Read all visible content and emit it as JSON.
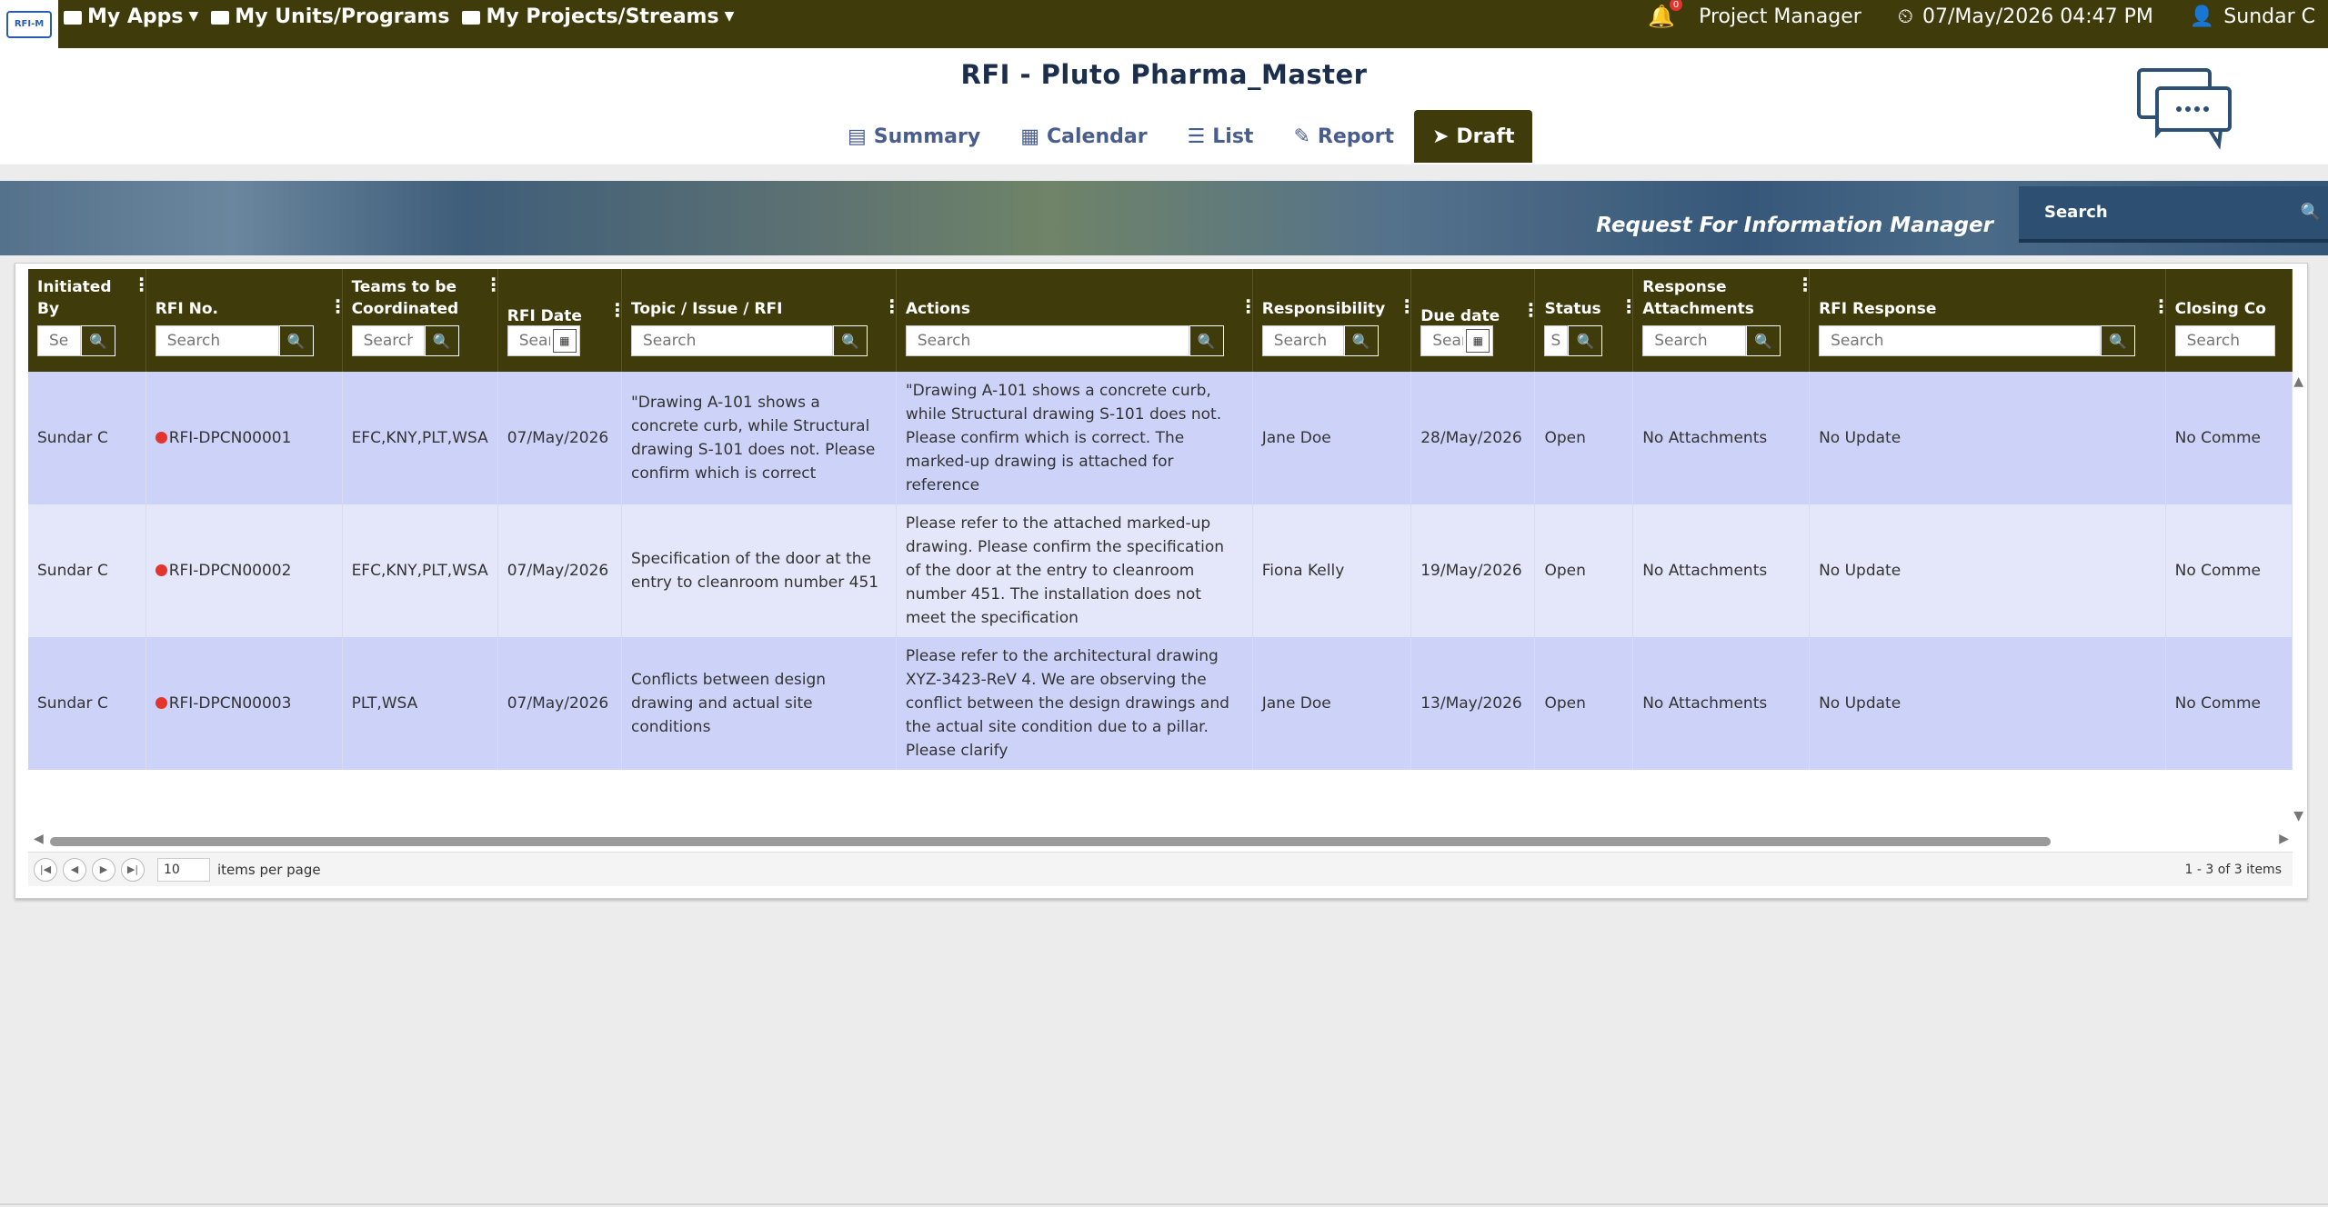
{
  "topbar": {
    "nav": [
      {
        "label": "My Apps",
        "icon": "briefcase-icon",
        "dropdown": true
      },
      {
        "label": "My Units/Programs",
        "icon": "briefcase-icon",
        "dropdown": false
      },
      {
        "label": "My Projects/Streams",
        "icon": "briefcase-icon",
        "dropdown": true
      }
    ],
    "notification_count": "0",
    "role": "Project Manager",
    "datetime": "07/May/2026 04:47 PM",
    "user": "Sundar C",
    "logo_text": "RFI-M"
  },
  "header": {
    "title": "RFI - Pluto Pharma_Master",
    "tabs": [
      {
        "label": "Summary",
        "icon": "summary-icon",
        "active": false
      },
      {
        "label": "Calendar",
        "icon": "calendar-icon",
        "active": false
      },
      {
        "label": "List",
        "icon": "list-icon",
        "active": false
      },
      {
        "label": "Report",
        "icon": "report-icon",
        "active": false
      },
      {
        "label": "Draft",
        "icon": "send-icon",
        "active": true
      }
    ]
  },
  "banner": {
    "title": "Request For Information Manager",
    "search_placeholder": "Search"
  },
  "grid": {
    "columns": [
      {
        "title": "Initiated By",
        "filter": "Sea"
      },
      {
        "title": "RFI No.",
        "filter": "Search"
      },
      {
        "title": "Teams to be Coordinated",
        "filter": "Search"
      },
      {
        "title": "RFI Date",
        "filter": "Searc",
        "date": true
      },
      {
        "title": "Topic / Issue / RFI",
        "filter": "Search"
      },
      {
        "title": "Actions",
        "filter": "Search"
      },
      {
        "title": "Responsibility",
        "filter": "Search"
      },
      {
        "title": "Due date",
        "filter": "Searc",
        "date": true
      },
      {
        "title": "Status",
        "filter": "S"
      },
      {
        "title": "Response Attachments",
        "filter": "Search"
      },
      {
        "title": "RFI Response",
        "filter": "Search"
      },
      {
        "title": "Closing Co",
        "filter": "Search"
      }
    ],
    "rows": [
      {
        "initiated_by": "Sundar C",
        "rfi_no": "RFI-DPCN00001",
        "teams": "EFC,KNY,PLT,WSA",
        "rfi_date": "07/May/2026",
        "topic": "\"Drawing A-101 shows a concrete curb, while Structural drawing S-101 does not. Please confirm which is correct",
        "actions": "\"Drawing A-101 shows a concrete curb, while Structural drawing S-101 does not. Please confirm which is correct. The marked-up drawing is attached for reference",
        "responsibility": "Jane Doe",
        "due_date": "28/May/2026",
        "status": "Open",
        "attachments": "No Attachments",
        "response": "No Update",
        "closing": "No Comme"
      },
      {
        "initiated_by": "Sundar C",
        "rfi_no": "RFI-DPCN00002",
        "teams": "EFC,KNY,PLT,WSA",
        "rfi_date": "07/May/2026",
        "topic": "Specification of the door at the entry to cleanroom number 451",
        "actions": "Please refer to the attached marked-up drawing. Please confirm the specification of the door at the entry to cleanroom number 451. The installation does not meet the specification",
        "responsibility": "Fiona Kelly",
        "due_date": "19/May/2026",
        "status": "Open",
        "attachments": "No Attachments",
        "response": "No Update",
        "closing": "No Comme"
      },
      {
        "initiated_by": "Sundar C",
        "rfi_no": "RFI-DPCN00003",
        "teams": "PLT,WSA",
        "rfi_date": "07/May/2026",
        "topic": "Conflicts between design drawing and actual site conditions",
        "actions": "Please refer to the architectural drawing XYZ-3423-ReV 4. We are observing the conflict between the design drawings and the actual site condition due to a pillar. Please clarify",
        "responsibility": "Jane Doe",
        "due_date": "13/May/2026",
        "status": "Open",
        "attachments": "No Attachments",
        "response": "No Update",
        "closing": "No Comme"
      }
    ]
  },
  "pager": {
    "page_size": "10",
    "items_per_page_label": "items per page",
    "info": "1 - 3 of 3 items"
  },
  "colors": {
    "brand": "#3f3b0a",
    "row_odd": "#cdd3f8",
    "row_even": "#e4e7fa",
    "status_open": "#e4342e",
    "title": "#1b2e4b"
  }
}
